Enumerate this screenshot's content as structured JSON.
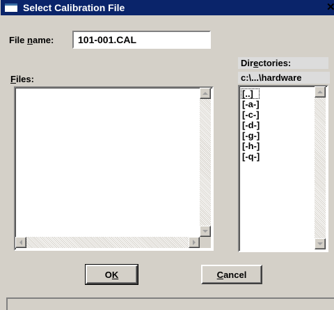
{
  "window": {
    "title": "Select Calibration File",
    "close_glyph": "✕"
  },
  "filename": {
    "label_pre": "File ",
    "label_accel": "n",
    "label_post": "ame:",
    "value": "101-001.CAL"
  },
  "files": {
    "label_accel": "F",
    "label_post": "iles:",
    "items": []
  },
  "directories": {
    "label_pre": "Dir",
    "label_accel": "e",
    "label_post": "ctories:",
    "current_path": "c:\\...\\hardware",
    "items": [
      "[..]",
      "[-a-]",
      "[-c-]",
      "[-d-]",
      "[-g-]",
      "[-h-]",
      "[-q-]"
    ]
  },
  "buttons": {
    "ok_pre": "O",
    "ok_accel": "K",
    "ok_post": "",
    "cancel_accel": "C",
    "cancel_post": "ancel"
  },
  "icons": {
    "title": "dialog-window-icon",
    "scroll_up": "arrow-up-icon",
    "scroll_down": "arrow-down-icon",
    "scroll_left": "arrow-left-icon",
    "scroll_right": "arrow-right-icon"
  },
  "colors": {
    "titlebar": "#0a246a",
    "face": "#d4d0c8",
    "field": "#ffffff"
  }
}
